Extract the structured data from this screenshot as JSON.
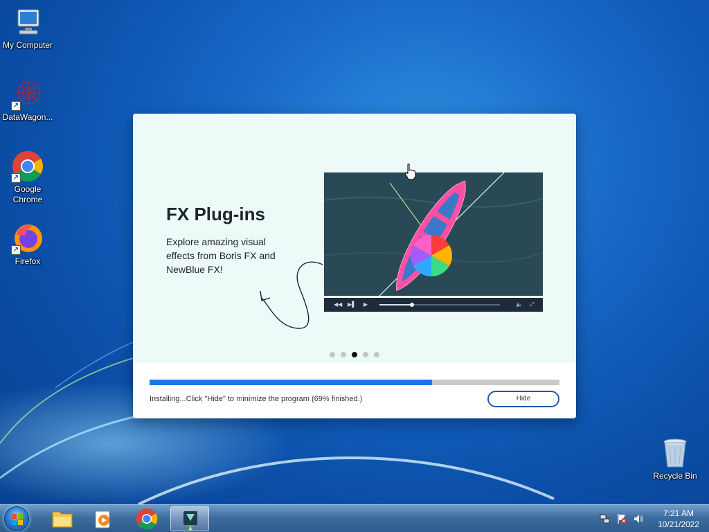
{
  "desktop": {
    "icons": [
      {
        "label": "My Computer"
      },
      {
        "label": "DataWagon..."
      },
      {
        "label": "Google Chrome"
      },
      {
        "label": "Firefox"
      },
      {
        "label": "Recycle Bin"
      }
    ]
  },
  "installer": {
    "slide": {
      "title": "FX Plug-ins",
      "description": "Explore amazing visual effects from Boris FX and NewBlue FX!"
    },
    "carousel": {
      "total": 5,
      "active_index": 2
    },
    "video_player": {
      "playback_progress": 0.27
    },
    "progress": {
      "percent": 69
    },
    "status_text": "Installing...Click \"Hide\" to minimize the program (69% finished.)",
    "hide_label": "Hide"
  },
  "taskbar": {
    "pinned": [
      "windows-explorer",
      "media-player",
      "google-chrome",
      "installer"
    ],
    "clock": {
      "time": "7:21 AM",
      "date": "10/21/2022"
    }
  },
  "colors": {
    "accent": "#1677e8",
    "hide_border": "#1f5aa6",
    "slide_bg": "#edfaf8"
  }
}
